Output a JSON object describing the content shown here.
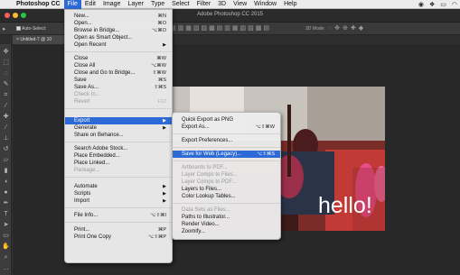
{
  "menubar": {
    "apple_glyph": "",
    "items": [
      "Photoshop CC",
      "File",
      "Edit",
      "Image",
      "Layer",
      "Type",
      "Select",
      "Filter",
      "3D",
      "View",
      "Window",
      "Help"
    ],
    "active": "File",
    "sys_icons": [
      "eye-icon",
      "dropbox-icon",
      "monitor-icon",
      "wifi-icon"
    ],
    "sys_glyphs": [
      "◉",
      "❖",
      "▭",
      "◠"
    ]
  },
  "window": {
    "title": "Adobe Photoshop CC 2015",
    "controls": {
      "close": "#fc5f57",
      "minimize": "#fdbc2e",
      "zoom": "#28c840"
    }
  },
  "options_bar": {
    "auto_select_label": "Auto-Select:",
    "mode_3d_label": "3D Mode:"
  },
  "document_tab": {
    "label": "Untitled-7 @ 10"
  },
  "canvas": {
    "overlay_text": "hello!"
  },
  "file_menu": {
    "groups": [
      [
        {
          "label": "New...",
          "shortcut": "⌘N"
        },
        {
          "label": "Open...",
          "shortcut": "⌘O"
        },
        {
          "label": "Browse in Bridge...",
          "shortcut": "⌥⌘O"
        },
        {
          "label": "Open as Smart Object...",
          "shortcut": ""
        },
        {
          "label": "Open Recent",
          "submenu": true
        }
      ],
      [
        {
          "label": "Close",
          "shortcut": "⌘W"
        },
        {
          "label": "Close All",
          "shortcut": "⌥⌘W"
        },
        {
          "label": "Close and Go to Bridge...",
          "shortcut": "⇧⌘W"
        },
        {
          "label": "Save",
          "shortcut": "⌘S"
        },
        {
          "label": "Save As...",
          "shortcut": "⇧⌘S"
        },
        {
          "label": "Check In...",
          "shortcut": "",
          "disabled": true
        },
        {
          "label": "Revert",
          "shortcut": "F12",
          "disabled": true
        }
      ],
      [
        {
          "label": "Export",
          "submenu": true,
          "highlighted": true
        },
        {
          "label": "Generate",
          "submenu": true
        },
        {
          "label": "Share on Behance...",
          "shortcut": ""
        }
      ],
      [
        {
          "label": "Search Adobe Stock...",
          "shortcut": ""
        },
        {
          "label": "Place Embedded...",
          "shortcut": ""
        },
        {
          "label": "Place Linked...",
          "shortcut": ""
        },
        {
          "label": "Package...",
          "shortcut": "",
          "disabled": true
        }
      ],
      [
        {
          "label": "Automate",
          "submenu": true
        },
        {
          "label": "Scripts",
          "submenu": true
        },
        {
          "label": "Import",
          "submenu": true
        }
      ],
      [
        {
          "label": "File Info...",
          "shortcut": "⌥⇧⌘I"
        }
      ],
      [
        {
          "label": "Print...",
          "shortcut": "⌘P"
        },
        {
          "label": "Print One Copy",
          "shortcut": "⌥⇧⌘P"
        }
      ]
    ]
  },
  "export_submenu": {
    "groups": [
      [
        {
          "label": "Quick Export as PNG",
          "shortcut": ""
        },
        {
          "label": "Export As...",
          "shortcut": "⌥⇧⌘W"
        }
      ],
      [
        {
          "label": "Export Preferences...",
          "shortcut": ""
        }
      ],
      [
        {
          "label": "Save for Web (Legacy)...",
          "shortcut": "⌥⇧⌘S",
          "highlighted": true
        }
      ],
      [
        {
          "label": "Artboards to PDF...",
          "shortcut": "",
          "disabled": true
        },
        {
          "label": "Layer Comps to Files...",
          "shortcut": "",
          "disabled": true
        },
        {
          "label": "Layer Comps to PDF...",
          "shortcut": "",
          "disabled": true
        },
        {
          "label": "Layers to Files...",
          "shortcut": ""
        },
        {
          "label": "Color Lookup Tables...",
          "shortcut": ""
        }
      ],
      [
        {
          "label": "Data Sets as Files...",
          "shortcut": "",
          "disabled": true
        },
        {
          "label": "Paths to Illustrator...",
          "shortcut": ""
        },
        {
          "label": "Render Video...",
          "shortcut": ""
        },
        {
          "label": "Zoomify...",
          "shortcut": ""
        }
      ]
    ]
  },
  "colors": {
    "menu_highlight": "#2d6ad6",
    "app_background": "#323232"
  }
}
